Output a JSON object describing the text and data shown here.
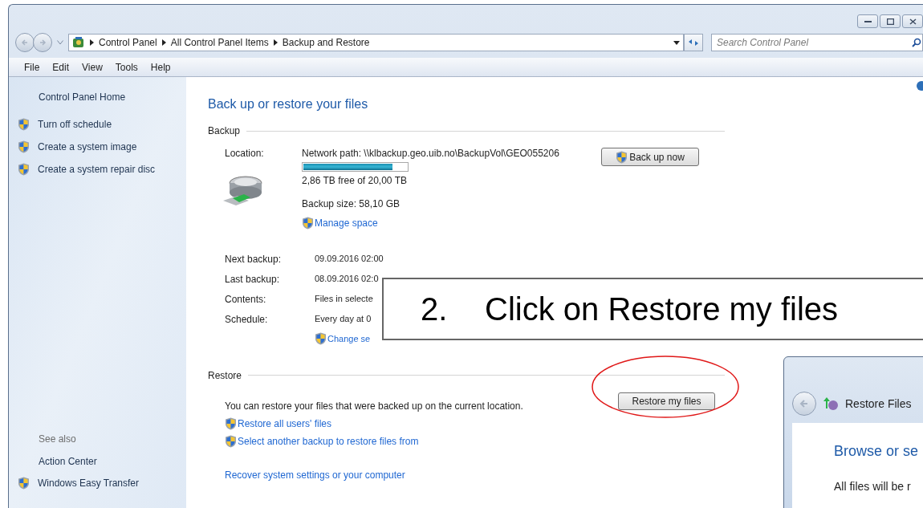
{
  "address_bar": {
    "crumbs": [
      "Control Panel",
      "All Control Panel Items",
      "Backup and Restore"
    ]
  },
  "search": {
    "placeholder": "Search Control Panel"
  },
  "menu": [
    "File",
    "Edit",
    "View",
    "Tools",
    "Help"
  ],
  "sidebar": {
    "home": "Control Panel Home",
    "tasks": [
      {
        "label": "Turn off schedule",
        "shield": true
      },
      {
        "label": "Create a system image",
        "shield": true
      },
      {
        "label": "Create a system repair disc",
        "shield": true
      }
    ],
    "see_also_title": "See also",
    "see_also": [
      {
        "label": "Action Center",
        "shield": false
      },
      {
        "label": "Windows Easy Transfer",
        "shield": true
      }
    ]
  },
  "main": {
    "title": "Back up or restore your files",
    "backup": {
      "heading": "Backup",
      "location_label": "Location:",
      "location": "Network path: \\\\klbackup.geo.uib.no\\BackupVol\\GEO055206",
      "storage": {
        "level": 0.86
      },
      "free": "2,86 TB free of 20,00 TB",
      "size": "Backup size: 58,10 GB",
      "manage_link": "Manage space",
      "button": "Back up now",
      "details": [
        {
          "label": "Next backup:",
          "value": "09.09.2016 02:00"
        },
        {
          "label": "Last backup:",
          "value": "08.09.2016 02:0"
        },
        {
          "label": "Contents:",
          "value": "Files in selecte"
        },
        {
          "label": "Schedule:",
          "value": "Every day at 0"
        }
      ],
      "change_link": "Change se"
    },
    "restore": {
      "heading": "Restore",
      "text": "You can restore your files that were backed up on the current location.",
      "button": "Restore my files",
      "links": [
        {
          "label": "Restore all users' files",
          "shield": true
        },
        {
          "label": "Select another backup to restore files from",
          "shield": true
        }
      ],
      "recover_link": "Recover system settings or your computer"
    }
  },
  "callout": {
    "number": "2.",
    "text": "Click on Restore my files"
  },
  "restore_dialog": {
    "title": "Restore Files",
    "heading": "Browse or se",
    "text": "All files will be r"
  }
}
